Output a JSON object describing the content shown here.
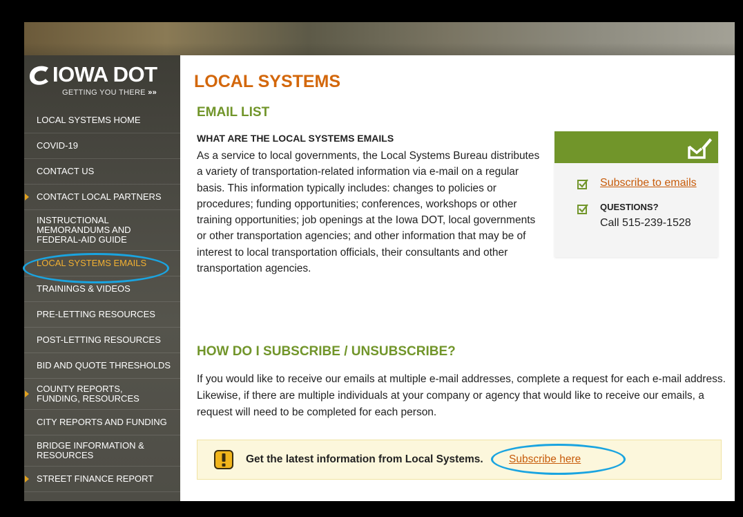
{
  "logo": {
    "brand": "IOWA DOT",
    "tagline": "GETTING YOU THERE"
  },
  "sidebar": {
    "items": [
      {
        "label": "LOCAL SYSTEMS HOME"
      },
      {
        "label": "COVID-19"
      },
      {
        "label": "CONTACT US"
      },
      {
        "label": "CONTACT LOCAL PARTNERS"
      },
      {
        "label": "INSTRUCTIONAL MEMORANDUMS AND FEDERAL-AID GUIDE"
      },
      {
        "label": "LOCAL SYSTEMS EMAILS"
      },
      {
        "label": "TRAININGS & VIDEOS"
      },
      {
        "label": "PRE-LETTING RESOURCES"
      },
      {
        "label": "POST-LETTING RESOURCES"
      },
      {
        "label": "BID AND QUOTE THRESHOLDS"
      },
      {
        "label": "COUNTY REPORTS, FUNDING, RESOURCES"
      },
      {
        "label": "CITY REPORTS AND FUNDING"
      },
      {
        "label": "BRIDGE INFORMATION & RESOURCES"
      },
      {
        "label": "STREET FINANCE REPORT"
      }
    ]
  },
  "main": {
    "title": "LOCAL SYSTEMS",
    "section_title": "EMAIL LIST",
    "sub_heading": "WHAT ARE THE LOCAL SYSTEMS EMAILS",
    "intro": "As a service to local governments, the Local Systems Bureau distributes a variety of transportation-related information via e-mail on a regular basis. This information typically includes: changes to policies or procedures; funding opportunities; conferences, workshops or other training opportunities; job openings at the Iowa DOT, local governments or other transportation agencies; and other information that may be of interest to local transportation officials, their consultants and other transportation agencies.",
    "subscribe_heading": "HOW DO I SUBSCRIBE / UNSUBSCRIBE?",
    "subscribe_text": "If you would like to receive our emails at multiple e-mail addresses, complete a request for each e-mail address. Likewise, if there are multiple individuals at your company or agency that would like to receive our emails, a request will need to be completed for each person."
  },
  "card": {
    "subscribe_link": "Subscribe to emails",
    "questions_label": "QUESTIONS?",
    "call_text": "Call 515-239-1528"
  },
  "callout": {
    "text": "Get the latest information from Local Systems.",
    "link": "Subscribe here"
  },
  "colors": {
    "accent_orange": "#d3670b",
    "accent_green": "#71952a",
    "link": "#c75b0a",
    "nav_active": "#f2b132",
    "highlight_circle": "#1aa4e0"
  }
}
